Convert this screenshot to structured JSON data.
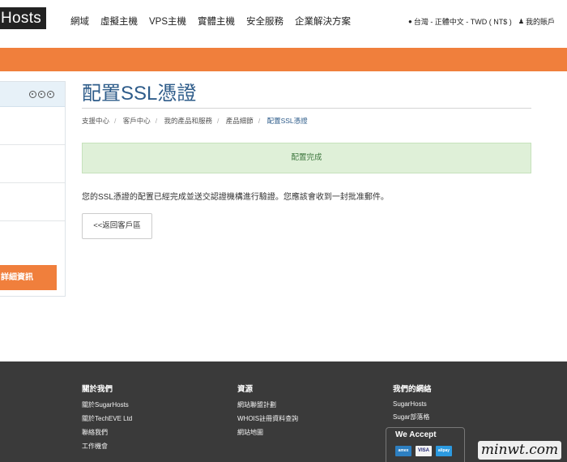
{
  "header": {
    "logo_text": "Hosts",
    "nav": [
      "網域",
      "虛擬主機",
      "VPS主機",
      "實體主機",
      "安全服務",
      "企業解決方案"
    ],
    "region_icon": "globe-icon",
    "region_label": "台灣 - 正體中文 - TWD ( NT$ )",
    "account_icon": "user-icon",
    "account_label": "我的賬戶"
  },
  "sidebar": {
    "detail_button": "詳細資訊"
  },
  "main": {
    "title": "配置SSL憑證",
    "breadcrumb": [
      "支援中心",
      "客戶中心",
      "我的產品和服務",
      "產品細節",
      "配置SSL憑證"
    ],
    "alert": "配置完成",
    "message": "您的SSL憑證的配置已經完成並送交認證機構進行驗證。您應該會收到一封批准郵件。",
    "back_button": "<<返回客戶區"
  },
  "footer": {
    "col1": {
      "title": "關於我們",
      "links": [
        "關於SugarHosts",
        "關於TechEVE Ltd",
        "聯絡我們",
        "工作機會"
      ]
    },
    "col2": {
      "title": "資源",
      "links": [
        "網站聯盟計劃",
        "WHOIS註冊資料查詢",
        "網站地圖"
      ]
    },
    "col3": {
      "title": "我們的網絡",
      "links": [
        "SugarHosts",
        "Sugar部落格"
      ]
    },
    "accept_title": "We Accept",
    "cards": [
      "amex",
      "VISA",
      "alipay"
    ]
  },
  "watermark": "minwt.com",
  "colors": {
    "accent": "#f07f3c",
    "title": "#2e5c8a",
    "footer": "#3a3a3a",
    "alert_bg": "#dff0d8"
  }
}
